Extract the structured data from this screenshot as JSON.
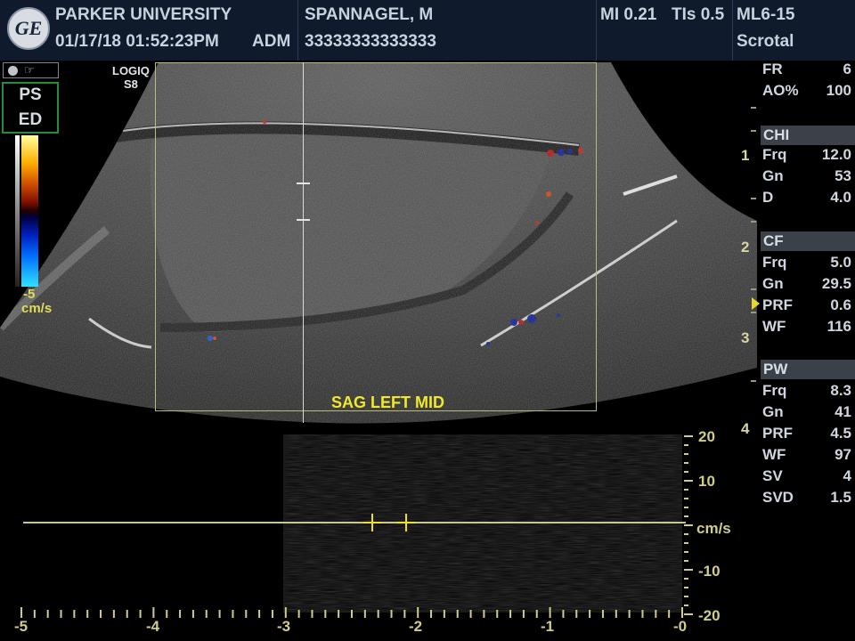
{
  "header": {
    "logo": "GE",
    "institution": "PARKER UNIVERSITY",
    "datetime": "01/17/18 01:52:23PM",
    "operator": "ADM",
    "patient_name": "SPANNAGEL, M",
    "patient_id": "33333333333333",
    "mi": "MI 0.21",
    "tis": "TIs 0.5",
    "probe": "ML6-15",
    "preset": "Scrotal"
  },
  "left_panel": {
    "mode_top": "PS",
    "mode_bottom": "ED",
    "scale_value": "-5",
    "scale_unit": "cm/s"
  },
  "image": {
    "system_label_1": "LOGIQ",
    "system_label_2": "S8",
    "annotation": "SAG LEFT MID"
  },
  "params": {
    "fr_label": "FR",
    "fr_value": "6",
    "ao_label": "AO%",
    "ao_value": "100",
    "chi_title": "CHI",
    "chi_frq_label": "Frq",
    "chi_frq_value": "12.0",
    "chi_gn_label": "Gn",
    "chi_gn_value": "53",
    "chi_d_label": "D",
    "chi_d_value": "4.0",
    "cf_title": "CF",
    "cf_frq_label": "Frq",
    "cf_frq_value": "5.0",
    "cf_gn_label": "Gn",
    "cf_gn_value": "29.5",
    "cf_prf_label": "PRF",
    "cf_prf_value": "0.6",
    "cf_wf_label": "WF",
    "cf_wf_value": "116",
    "pw_title": "PW",
    "pw_frq_label": "Frq",
    "pw_frq_value": "8.3",
    "pw_gn_label": "Gn",
    "pw_gn_value": "41",
    "pw_prf_label": "PRF",
    "pw_prf_value": "4.5",
    "pw_wf_label": "WF",
    "pw_wf_value": "97",
    "pw_sv_label": "SV",
    "pw_sv_value": "4",
    "pw_svd_label": "SVD",
    "pw_svd_value": "1.5"
  },
  "depth_scale": {
    "marks": [
      "1",
      "2",
      "3",
      "4"
    ]
  },
  "spectrum": {
    "y_ticks": [
      "20",
      "10",
      "-10",
      "-20"
    ],
    "y_unit": "cm/s",
    "x_ticks": [
      "-5",
      "-4",
      "-3",
      "-2",
      "-1",
      "-0"
    ]
  },
  "colors": {
    "header_bg": "#0f1a2d",
    "annotation": "#f2e82a",
    "baseline": "#c8c890",
    "mode_border": "#1f8f3a",
    "section_bg": "#3c4048"
  }
}
